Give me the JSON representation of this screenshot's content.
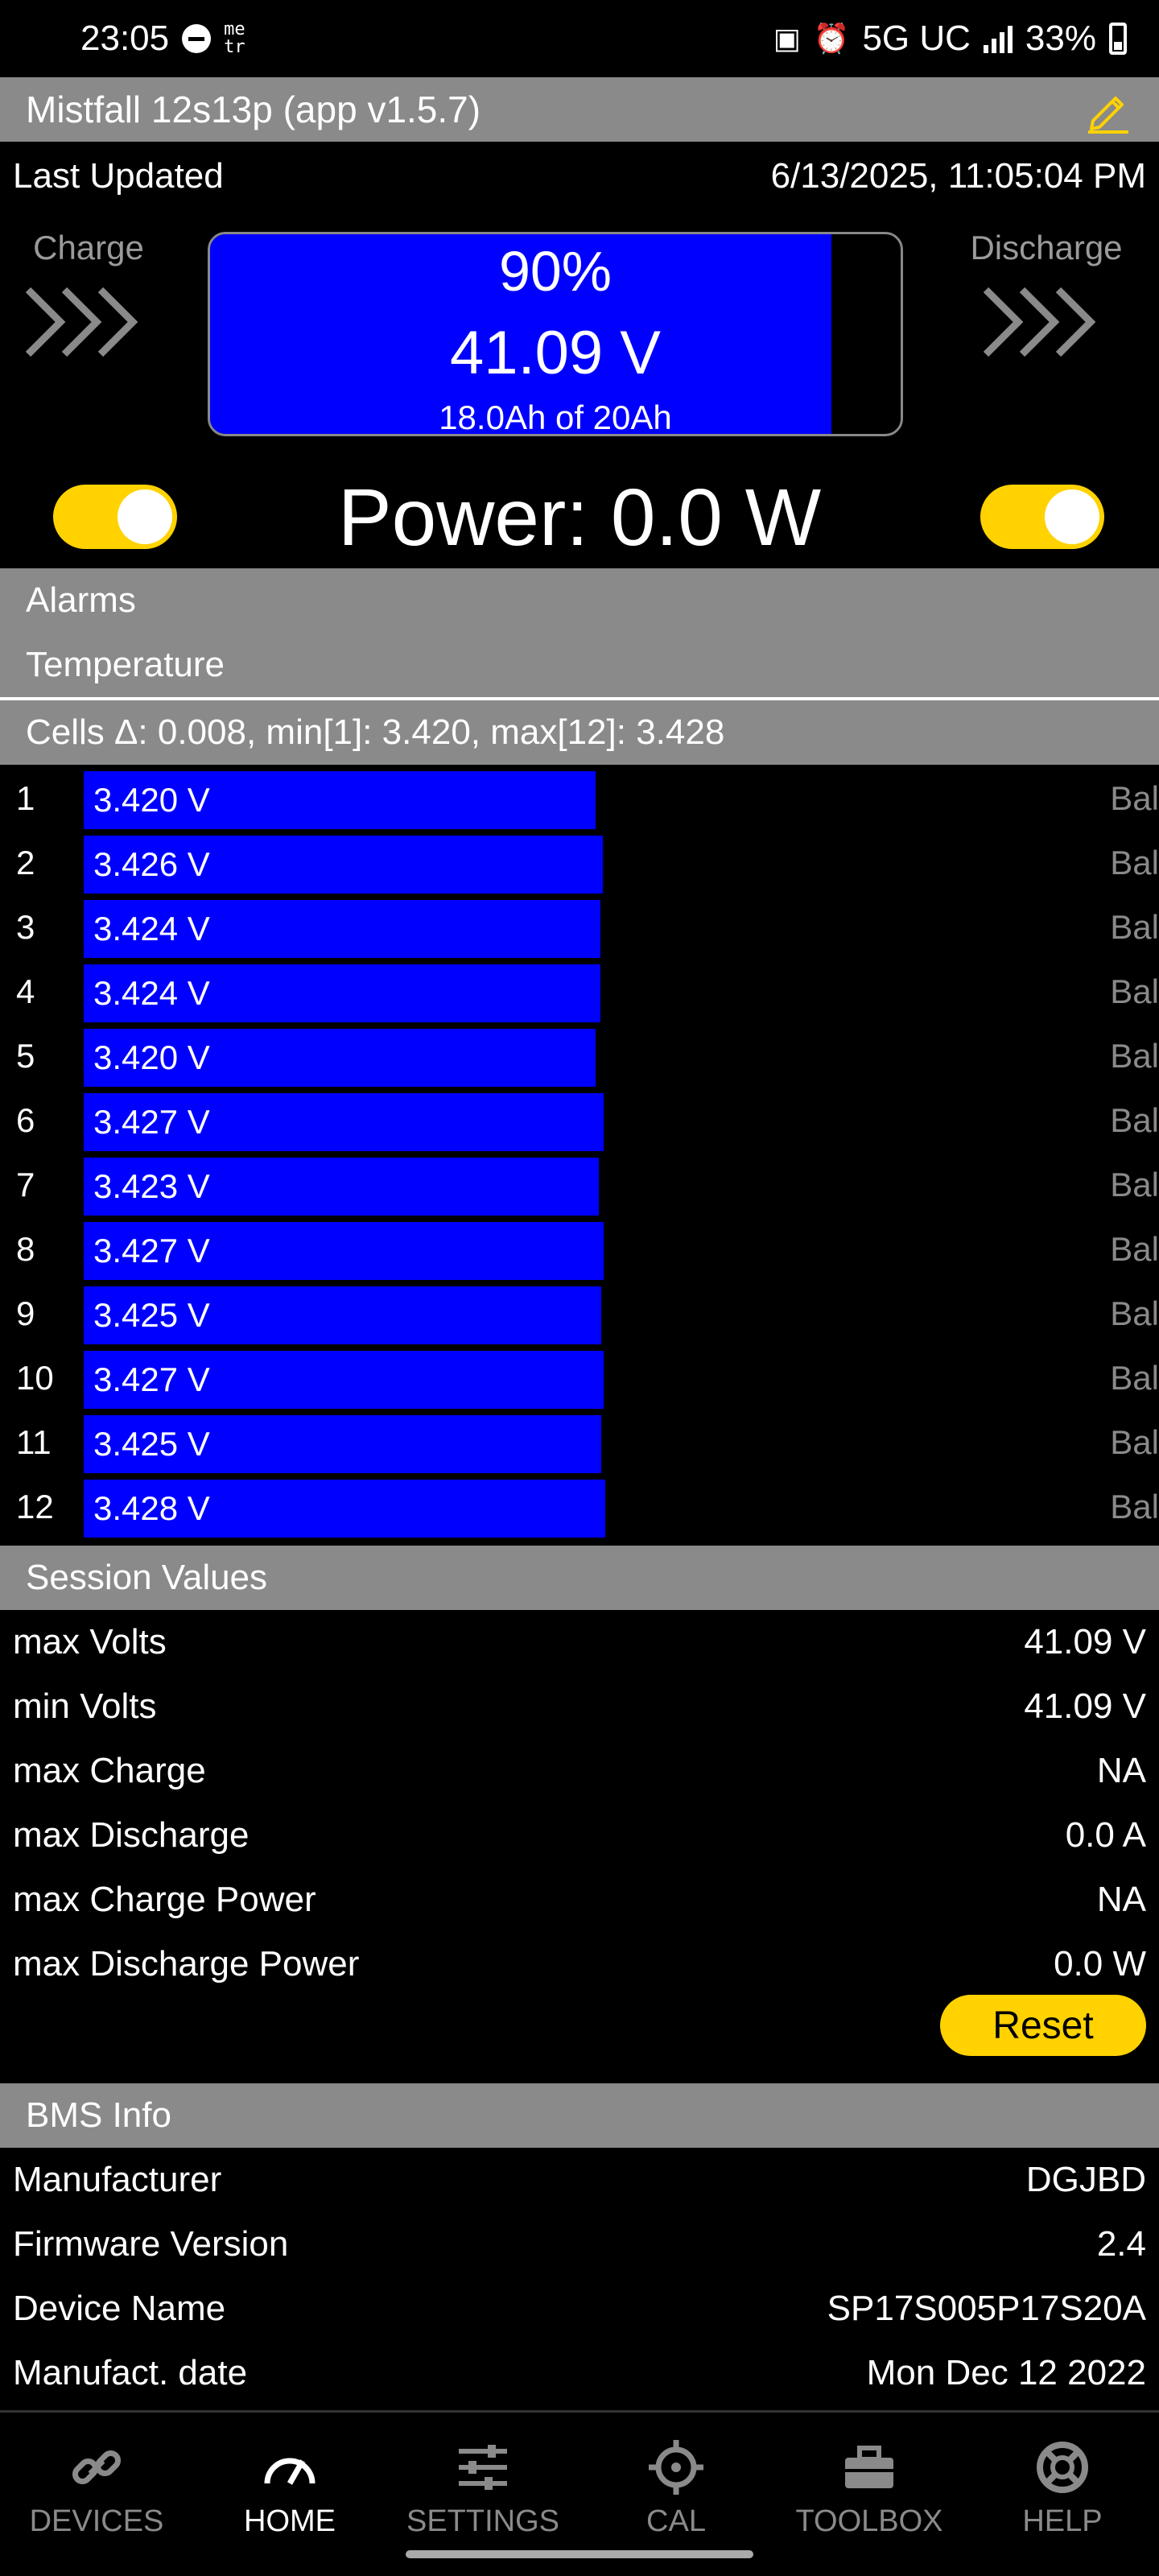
{
  "status_bar": {
    "time": "23:05",
    "carrier_glyph": "me\ntr",
    "network": "5G UC",
    "battery_pct": "33%",
    "battery_level": 0.33
  },
  "title_bar": {
    "title": "Mistfall 12s13p (app v1.5.7)",
    "edit_icon": "pencil-icon",
    "accent_color": "#ffd200"
  },
  "last_updated": {
    "label": "Last Updated",
    "value": "6/13/2025, 11:05:04 PM"
  },
  "gauge": {
    "charge_label": "Charge",
    "discharge_label": "Discharge",
    "soc_text": "90%",
    "soc_fraction": 0.9,
    "voltage_text": "41.09 V",
    "capacity_text": "18.0Ah of 20Ah",
    "fill_color": "#0000ff"
  },
  "power": {
    "text": "Power: 0.0 W",
    "charge_toggle_on": true,
    "discharge_toggle_on": true
  },
  "sections": {
    "alarms": "Alarms",
    "temperature": "Temperature",
    "cells_summary": "Cells Δ: 0.008, min[1]: 3.420, max[12]: 3.428",
    "session": "Session Values",
    "bms_info": "BMS Info"
  },
  "cells": {
    "bal_label": "Bal",
    "scale_min": 3.0,
    "scale_max": 3.65,
    "rows": [
      {
        "num": "1",
        "volts": "3.420 V",
        "value": 3.42
      },
      {
        "num": "2",
        "volts": "3.426 V",
        "value": 3.426
      },
      {
        "num": "3",
        "volts": "3.424 V",
        "value": 3.424
      },
      {
        "num": "4",
        "volts": "3.424 V",
        "value": 3.424
      },
      {
        "num": "5",
        "volts": "3.420 V",
        "value": 3.42
      },
      {
        "num": "6",
        "volts": "3.427 V",
        "value": 3.427
      },
      {
        "num": "7",
        "volts": "3.423 V",
        "value": 3.423
      },
      {
        "num": "8",
        "volts": "3.427 V",
        "value": 3.427
      },
      {
        "num": "9",
        "volts": "3.425 V",
        "value": 3.425
      },
      {
        "num": "10",
        "volts": "3.427 V",
        "value": 3.427
      },
      {
        "num": "11",
        "volts": "3.425 V",
        "value": 3.425
      },
      {
        "num": "12",
        "volts": "3.428 V",
        "value": 3.428
      }
    ]
  },
  "session": {
    "rows": [
      {
        "label": "max Volts",
        "value": "41.09 V"
      },
      {
        "label": "min Volts",
        "value": "41.09 V"
      },
      {
        "label": "max Charge",
        "value": "NA"
      },
      {
        "label": "max Discharge",
        "value": "0.0 A"
      },
      {
        "label": "max Charge Power",
        "value": "NA"
      },
      {
        "label": "max Discharge Power",
        "value": "0.0 W"
      }
    ],
    "reset_label": "Reset"
  },
  "bms": {
    "rows": [
      {
        "label": "Manufacturer",
        "value": "DGJBD"
      },
      {
        "label": "Firmware Version",
        "value": "2.4"
      },
      {
        "label": "Device Name",
        "value": "SP17S005P17S20A"
      },
      {
        "label": "Manufact. date",
        "value": "Mon Dec 12 2022"
      }
    ]
  },
  "nav": {
    "items": [
      {
        "label": "DEVICES",
        "icon": "link-icon",
        "active": false
      },
      {
        "label": "HOME",
        "icon": "gauge-icon",
        "active": true
      },
      {
        "label": "SETTINGS",
        "icon": "sliders-icon",
        "active": false
      },
      {
        "label": "CAL",
        "icon": "crosshair-icon",
        "active": false
      },
      {
        "label": "TOOLBOX",
        "icon": "toolbox-icon",
        "active": false
      },
      {
        "label": "HELP",
        "icon": "lifebuoy-icon",
        "active": false
      }
    ]
  }
}
